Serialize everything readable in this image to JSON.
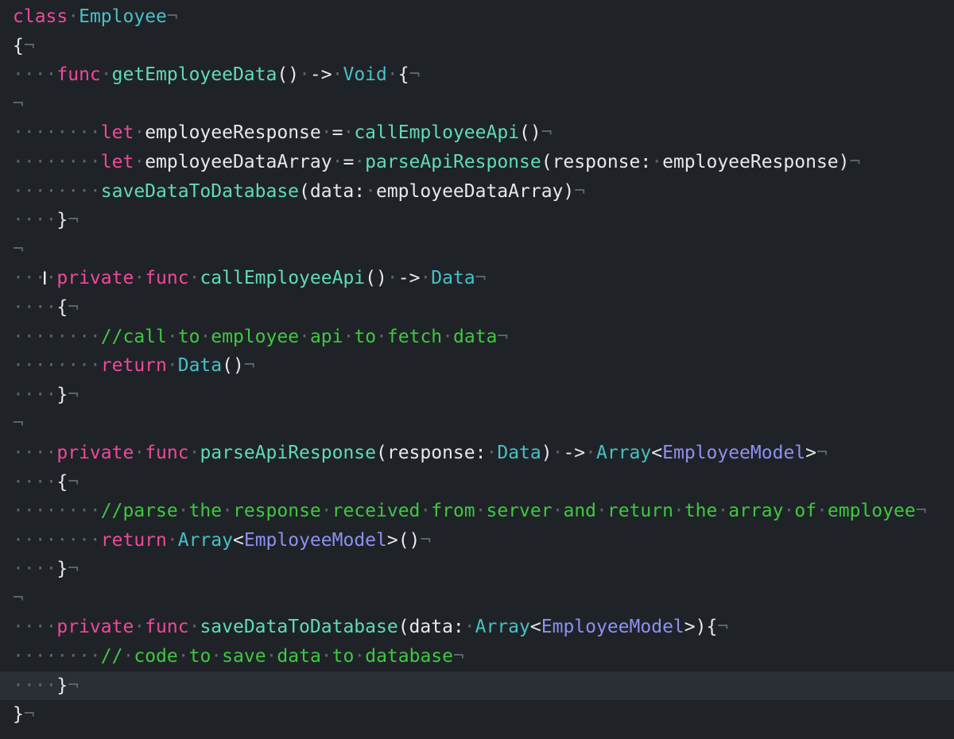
{
  "theme": {
    "background": "#1f2328",
    "current_line": "#2a2f35",
    "keyword": "#f0489a",
    "type": "#46c1c5",
    "function": "#5fdbb8",
    "comment": "#3fc83f",
    "class_ref": "#8f8ff0",
    "plain": "#e6e8ea",
    "invisible": "#5c636b"
  },
  "cursor": {
    "glyph": "I",
    "icon": "text-cursor-icon"
  },
  "lines": [
    [
      [
        "kw",
        "class"
      ],
      [
        "ws",
        "·"
      ],
      [
        "ty",
        "Employee"
      ],
      [
        "ws",
        "¬"
      ]
    ],
    [
      [
        "pl",
        "{"
      ],
      [
        "ws",
        "¬"
      ]
    ],
    [
      [
        "ws",
        "····"
      ],
      [
        "kw",
        "func"
      ],
      [
        "ws",
        "·"
      ],
      [
        "fn",
        "getEmployeeData"
      ],
      [
        "pl",
        "()"
      ],
      [
        "ws",
        "·"
      ],
      [
        "pl",
        "->"
      ],
      [
        "ws",
        "·"
      ],
      [
        "ty",
        "Void"
      ],
      [
        "ws",
        "·"
      ],
      [
        "pl",
        "{"
      ],
      [
        "ws",
        "¬"
      ]
    ],
    [
      [
        "ws",
        "¬"
      ]
    ],
    [
      [
        "ws",
        "········"
      ],
      [
        "kw",
        "let"
      ],
      [
        "ws",
        "·"
      ],
      [
        "pl",
        "employeeResponse"
      ],
      [
        "ws",
        "·"
      ],
      [
        "pl",
        "="
      ],
      [
        "ws",
        "·"
      ],
      [
        "fn",
        "callEmployeeApi"
      ],
      [
        "pl",
        "()"
      ],
      [
        "ws",
        "¬"
      ]
    ],
    [
      [
        "ws",
        "········"
      ],
      [
        "kw",
        "let"
      ],
      [
        "ws",
        "·"
      ],
      [
        "pl",
        "employeeDataArray"
      ],
      [
        "ws",
        "·"
      ],
      [
        "pl",
        "="
      ],
      [
        "ws",
        "·"
      ],
      [
        "fn",
        "parseApiResponse"
      ],
      [
        "pl",
        "(response:"
      ],
      [
        "ws",
        "·"
      ],
      [
        "pl",
        "employeeResponse)"
      ],
      [
        "ws",
        "¬"
      ]
    ],
    [
      [
        "ws",
        "········"
      ],
      [
        "fn",
        "saveDataToDatabase"
      ],
      [
        "pl",
        "(data:"
      ],
      [
        "ws",
        "·"
      ],
      [
        "pl",
        "employeeDataArray)"
      ],
      [
        "ws",
        "¬"
      ]
    ],
    [
      [
        "ws",
        "····"
      ],
      [
        "pl",
        "}"
      ],
      [
        "ws",
        "¬"
      ]
    ],
    [
      [
        "ws",
        "¬"
      ]
    ],
    [
      [
        "ws",
        "····"
      ],
      [
        "kw",
        "private"
      ],
      [
        "ws",
        "·"
      ],
      [
        "kw",
        "func"
      ],
      [
        "ws",
        "·"
      ],
      [
        "fn",
        "callEmployeeApi"
      ],
      [
        "pl",
        "()"
      ],
      [
        "ws",
        "·"
      ],
      [
        "pl",
        "->"
      ],
      [
        "ws",
        "·"
      ],
      [
        "ty",
        "Data"
      ],
      [
        "ws",
        "¬"
      ]
    ],
    [
      [
        "ws",
        "····"
      ],
      [
        "pl",
        "{"
      ],
      [
        "ws",
        "¬"
      ]
    ],
    [
      [
        "ws",
        "········"
      ],
      [
        "cm",
        "//call"
      ],
      [
        "ws",
        "·"
      ],
      [
        "cm",
        "to"
      ],
      [
        "ws",
        "·"
      ],
      [
        "cm",
        "employee"
      ],
      [
        "ws",
        "·"
      ],
      [
        "cm",
        "api"
      ],
      [
        "ws",
        "·"
      ],
      [
        "cm",
        "to"
      ],
      [
        "ws",
        "·"
      ],
      [
        "cm",
        "fetch"
      ],
      [
        "ws",
        "·"
      ],
      [
        "cm",
        "data"
      ],
      [
        "ws",
        "¬"
      ]
    ],
    [
      [
        "ws",
        "········"
      ],
      [
        "kw",
        "return"
      ],
      [
        "ws",
        "·"
      ],
      [
        "ty",
        "Data"
      ],
      [
        "pl",
        "()"
      ],
      [
        "ws",
        "¬"
      ]
    ],
    [
      [
        "ws",
        "····"
      ],
      [
        "pl",
        "}"
      ],
      [
        "ws",
        "¬"
      ]
    ],
    [
      [
        "ws",
        "¬"
      ]
    ],
    [
      [
        "ws",
        "····"
      ],
      [
        "kw",
        "private"
      ],
      [
        "ws",
        "·"
      ],
      [
        "kw",
        "func"
      ],
      [
        "ws",
        "·"
      ],
      [
        "fn",
        "parseApiResponse"
      ],
      [
        "pl",
        "(response:"
      ],
      [
        "ws",
        "·"
      ],
      [
        "ty",
        "Data"
      ],
      [
        "pl",
        ")"
      ],
      [
        "ws",
        "·"
      ],
      [
        "pl",
        "->"
      ],
      [
        "ws",
        "·"
      ],
      [
        "ty",
        "Array"
      ],
      [
        "pl",
        "<"
      ],
      [
        "cls",
        "EmployeeModel"
      ],
      [
        "pl",
        ">"
      ],
      [
        "ws",
        "¬"
      ]
    ],
    [
      [
        "ws",
        "····"
      ],
      [
        "pl",
        "{"
      ],
      [
        "ws",
        "¬"
      ]
    ],
    [
      [
        "ws",
        "········"
      ],
      [
        "cm",
        "//parse"
      ],
      [
        "ws",
        "·"
      ],
      [
        "cm",
        "the"
      ],
      [
        "ws",
        "·"
      ],
      [
        "cm",
        "response"
      ],
      [
        "ws",
        "·"
      ],
      [
        "cm",
        "received"
      ],
      [
        "ws",
        "·"
      ],
      [
        "cm",
        "from"
      ],
      [
        "ws",
        "·"
      ],
      [
        "cm",
        "server"
      ],
      [
        "ws",
        "·"
      ],
      [
        "cm",
        "and"
      ],
      [
        "ws",
        "·"
      ],
      [
        "cm",
        "return"
      ],
      [
        "ws",
        "·"
      ],
      [
        "cm",
        "the"
      ],
      [
        "ws",
        "·"
      ],
      [
        "cm",
        "array"
      ],
      [
        "ws",
        "·"
      ],
      [
        "cm",
        "of"
      ],
      [
        "ws",
        "·"
      ],
      [
        "cm",
        "employee"
      ],
      [
        "ws",
        "¬"
      ]
    ],
    [
      [
        "ws",
        "········"
      ],
      [
        "kw",
        "return"
      ],
      [
        "ws",
        "·"
      ],
      [
        "ty",
        "Array"
      ],
      [
        "pl",
        "<"
      ],
      [
        "cls",
        "EmployeeModel"
      ],
      [
        "pl",
        ">()"
      ],
      [
        "ws",
        "¬"
      ]
    ],
    [
      [
        "ws",
        "····"
      ],
      [
        "pl",
        "}"
      ],
      [
        "ws",
        "¬"
      ]
    ],
    [
      [
        "ws",
        "¬"
      ]
    ],
    [
      [
        "ws",
        "····"
      ],
      [
        "kw",
        "private"
      ],
      [
        "ws",
        "·"
      ],
      [
        "kw",
        "func"
      ],
      [
        "ws",
        "·"
      ],
      [
        "fn",
        "saveDataToDatabase"
      ],
      [
        "pl",
        "(data:"
      ],
      [
        "ws",
        "·"
      ],
      [
        "ty",
        "Array"
      ],
      [
        "pl",
        "<"
      ],
      [
        "cls",
        "EmployeeModel"
      ],
      [
        "pl",
        ">){"
      ],
      [
        "ws",
        "¬"
      ]
    ],
    [
      [
        "ws",
        "········"
      ],
      [
        "cm",
        "//"
      ],
      [
        "ws",
        "·"
      ],
      [
        "cm",
        "code"
      ],
      [
        "ws",
        "·"
      ],
      [
        "cm",
        "to"
      ],
      [
        "ws",
        "·"
      ],
      [
        "cm",
        "save"
      ],
      [
        "ws",
        "·"
      ],
      [
        "cm",
        "data"
      ],
      [
        "ws",
        "·"
      ],
      [
        "cm",
        "to"
      ],
      [
        "ws",
        "·"
      ],
      [
        "cm",
        "database"
      ],
      [
        "ws",
        "¬"
      ]
    ],
    [
      [
        "ws",
        "····"
      ],
      [
        "pl",
        "}"
      ],
      [
        "ws",
        "¬"
      ]
    ],
    [
      [
        "pl",
        "}"
      ],
      [
        "ws",
        "¬"
      ]
    ]
  ]
}
